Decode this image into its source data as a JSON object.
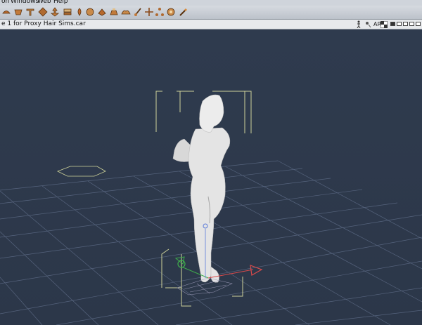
{
  "menubar": {
    "items": [
      "on",
      "Windows",
      "Web",
      "Help"
    ]
  },
  "toolbar": {
    "icons": [
      "rotate-tool-icon",
      "twist-tool-icon",
      "taper-tool-icon",
      "scale-tool-icon",
      "translate-tool-icon",
      "translate-in-out-icon",
      "chain-break-icon",
      "color-tool-icon",
      "grouping-tool-icon",
      "view-magnifier-icon",
      "direct-manipulation-icon",
      "morph-brush-icon",
      "grab-tool-icon",
      "joint-editor-icon",
      "wand-tool-icon",
      "target-box-icon",
      "settings-icon",
      "pick-icon"
    ]
  },
  "tabbar": {
    "document_title": "e 1 for Proxy Hair Sims.car",
    "view_label": "AR"
  },
  "colors": {
    "viewport_bg": "#2e3a4d",
    "grid": "#5d6b86",
    "figure": "#e4e4e4",
    "bbox": "#cfd39a",
    "axis_red": "#d94a4a",
    "axis_green": "#3fae4c"
  }
}
